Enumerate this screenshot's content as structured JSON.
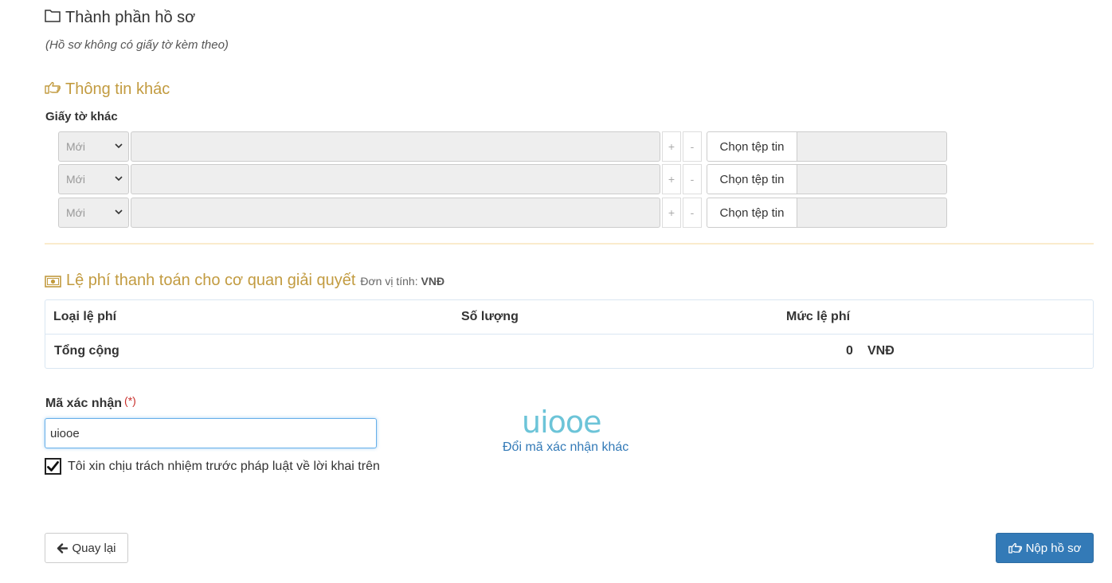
{
  "ho_so": {
    "title": "Thành phần hồ sơ",
    "note": "(Hồ sơ không có giấy tờ kèm theo)"
  },
  "thong_tin_khac": {
    "title": "Thông tin khác",
    "label": "Giấy tờ khác",
    "rows": [
      {
        "select_value": "Mới",
        "plus": "+",
        "minus": "-",
        "file_button": "Chọn tệp tin"
      },
      {
        "select_value": "Mới",
        "plus": "+",
        "minus": "-",
        "file_button": "Chọn tệp tin"
      },
      {
        "select_value": "Mới",
        "plus": "+",
        "minus": "-",
        "file_button": "Chọn tệp tin"
      }
    ]
  },
  "le_phi": {
    "title": "Lệ phí thanh toán cho cơ quan giải quyết",
    "unit_label": "Đơn vị tính:",
    "unit_value": "VNĐ",
    "headers": [
      "Loại lệ phí",
      "Số lượng",
      "Mức lệ phí"
    ],
    "total_label": "Tổng cộng",
    "total_value": "0",
    "total_currency": "VNĐ"
  },
  "captcha": {
    "label": "Mã xác nhận",
    "required_mark": "(*)",
    "input_value": "uiooe",
    "image_text": "uiooe",
    "refresh_link": "Đổi mã xác nhận khác"
  },
  "agreement": {
    "checked": true,
    "text": "Tôi xin chịu trách nhiệm trước pháp luật về lời khai trên"
  },
  "buttons": {
    "back": "Quay lại",
    "submit": "Nộp hồ sơ"
  },
  "colors": {
    "section_title": "#c29b40",
    "primary": "#337ab7",
    "link": "#337ab7",
    "required": "#c9302c",
    "captcha_text": "#6cc4d8"
  },
  "icons": {
    "section1": "folder-open-icon",
    "section2": "hand-point-right-icon",
    "section3": "money-icon",
    "back": "arrow-left-icon",
    "submit": "hand-point-right-icon"
  }
}
